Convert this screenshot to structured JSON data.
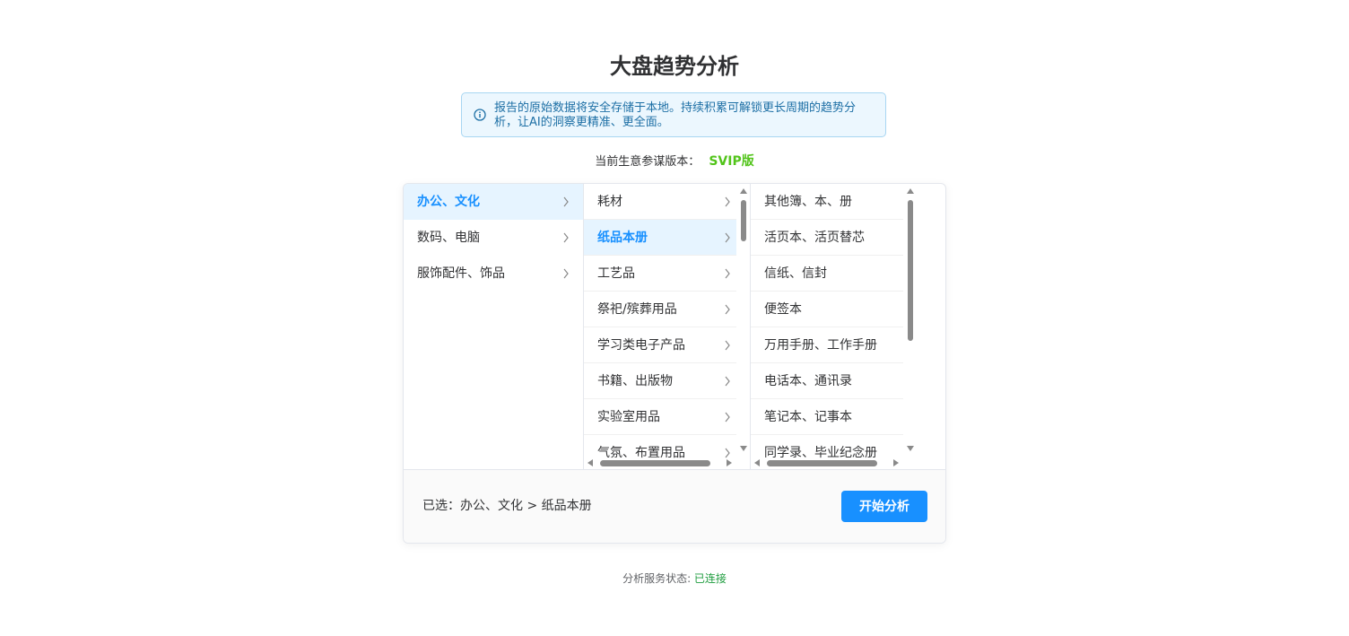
{
  "page": {
    "title": "大盘趋势分析",
    "notice": "报告的原始数据将安全存储于本地。持续积累可解锁更长周期的趋势分析，让AI的洞察更精准、更全面。",
    "version_label": "当前生意参谋版本：",
    "version_value": "SVIP版"
  },
  "cascader": {
    "level1": [
      {
        "label": "办公、文化",
        "active": true
      },
      {
        "label": "数码、电脑",
        "active": false
      },
      {
        "label": "服饰配件、饰品",
        "active": false
      }
    ],
    "level2": [
      {
        "label": "耗材",
        "active": false
      },
      {
        "label": "纸品本册",
        "active": true
      },
      {
        "label": "工艺品",
        "active": false
      },
      {
        "label": "祭祀/殡葬用品",
        "active": false
      },
      {
        "label": "学习类电子产品",
        "active": false
      },
      {
        "label": "书籍、出版物",
        "active": false
      },
      {
        "label": "实验室用品",
        "active": false
      },
      {
        "label": "气氛、布置用品",
        "active": false
      }
    ],
    "level3": [
      {
        "label": "其他簿、本、册"
      },
      {
        "label": "活页本、活页替芯"
      },
      {
        "label": "信纸、信封"
      },
      {
        "label": "便签本"
      },
      {
        "label": "万用手册、工作手册"
      },
      {
        "label": "电话本、通讯录"
      },
      {
        "label": "笔记本、记事本"
      },
      {
        "label": "同学录、毕业纪念册"
      }
    ]
  },
  "footer": {
    "selected_text": "已选：办公、文化 > 纸品本册",
    "start_button": "开始分析"
  },
  "status": {
    "label": "分析服务状态: ",
    "value": "已连接"
  },
  "colors": {
    "accent": "#1890ff",
    "svip": "#52c41a",
    "connected": "#1f9d3f"
  },
  "icons": {
    "notice": "info-circle-icon",
    "submenu": "chevron-right-icon"
  }
}
